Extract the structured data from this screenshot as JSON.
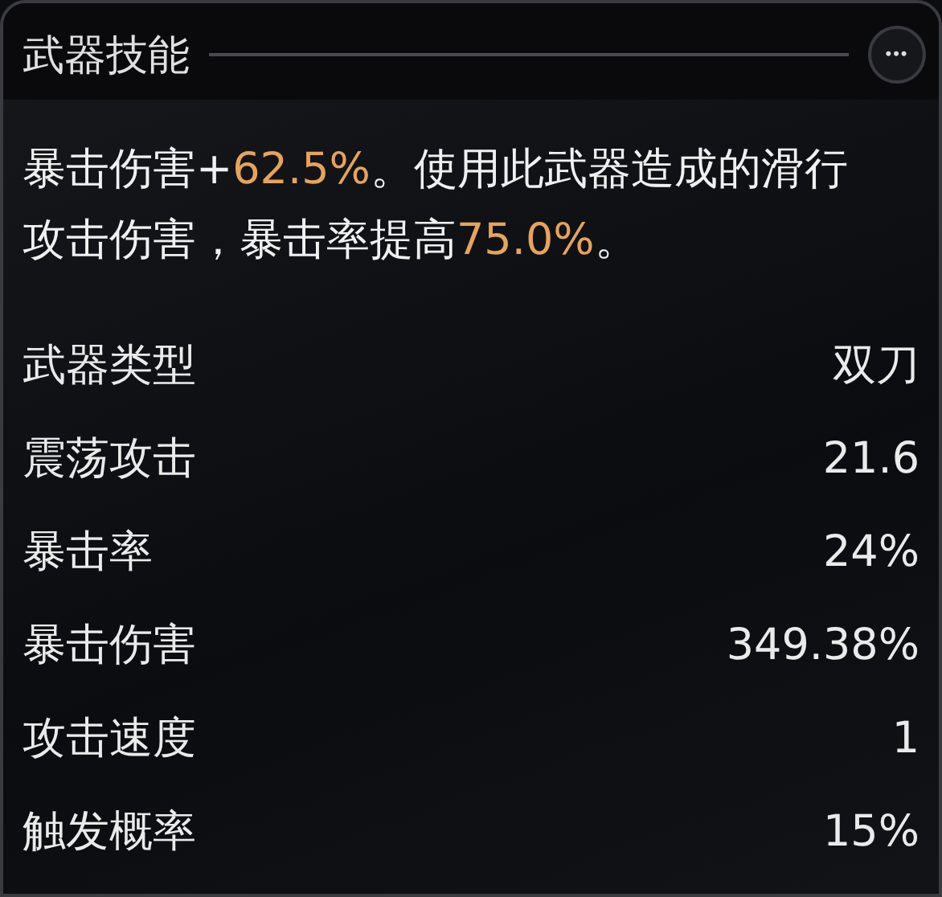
{
  "header": {
    "title": "武器技能",
    "menu_button": "•••"
  },
  "description": [
    {
      "text": "暴击伤害+",
      "highlight": false
    },
    {
      "text": "62.5%",
      "highlight": true
    },
    {
      "text": "。使用此武器造成的滑行攻击伤害，暴击率提高",
      "highlight": false
    },
    {
      "text": "75.0%",
      "highlight": true
    },
    {
      "text": "。",
      "highlight": false
    }
  ],
  "stats": [
    {
      "label": "武器类型",
      "value": "双刀"
    },
    {
      "label": "震荡攻击",
      "value": "21.6"
    },
    {
      "label": "暴击率",
      "value": "24%"
    },
    {
      "label": "暴击伤害",
      "value": "349.38%"
    },
    {
      "label": "攻击速度",
      "value": "1"
    },
    {
      "label": "触发概率",
      "value": "15%"
    }
  ]
}
